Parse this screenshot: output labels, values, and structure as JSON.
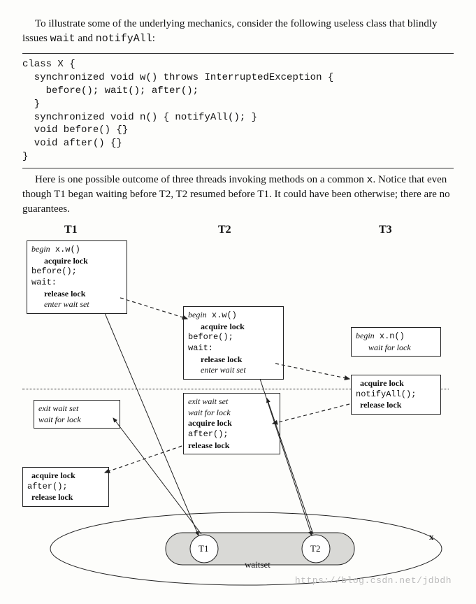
{
  "intro1": "To illustrate some of the underlying mechanics, consider the following useless class that blindly issues ",
  "intro1_code1": "wait",
  "intro1_mid": " and ",
  "intro1_code2": "notifyAll",
  "intro1_end": ":",
  "code": "class X {\n  synchronized void w() throws InterruptedException {\n    before(); wait(); after();\n  }\n  synchronized void n() { notifyAll(); }\n  void before() {}\n  void after() {}\n}",
  "intro2_a": "Here is one possible outcome of three threads invoking methods on a common ",
  "intro2_code": "x",
  "intro2_b": ". Notice that even though T1 began waiting before T2, T2 resumed before T1. It could have been otherwise; there are no guarantees.",
  "heads": {
    "t1": "T1",
    "t2": "T2",
    "t3": "T3"
  },
  "box_t1_a": {
    "l1a": "begin",
    "l1b": " x.w()",
    "l2": "acquire lock",
    "l3": "before();",
    "l4": "wait:",
    "l5": "release lock",
    "l6": "enter wait set"
  },
  "box_t2_a": {
    "l1a": "begin",
    "l1b": " x.w()",
    "l2": "acquire lock",
    "l3": "before();",
    "l4": "wait:",
    "l5": "release lock",
    "l6": "enter wait set"
  },
  "box_t3_a": {
    "l1a": "begin",
    "l1b": " x.n()",
    "l2": "wait for lock"
  },
  "box_t3_b": {
    "l1": "acquire lock",
    "l2": "notifyAll();",
    "l3": "release lock"
  },
  "box_t1_b": {
    "l1": "exit wait set",
    "l2": "wait for lock"
  },
  "box_t2_b": {
    "l1": "exit wait set",
    "l2": "wait for lock",
    "l3": "acquire lock",
    "l4": "after();",
    "l5": "release lock"
  },
  "box_t1_c": {
    "l1": "acquire lock",
    "l2": "after();",
    "l3": "release lock"
  },
  "waitset": {
    "t1": "T1",
    "t2": "T2",
    "label": "waitset",
    "x": "x"
  },
  "watermark": "https://blog.csdn.net/jdbdh"
}
